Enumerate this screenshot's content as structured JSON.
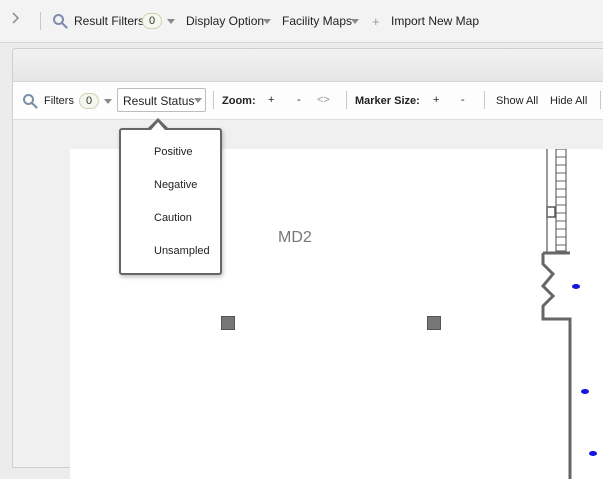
{
  "top_toolbar": {
    "result_filters_label": "Result Filters",
    "result_filters_count": "0",
    "display_option_label": "Display Option",
    "facility_maps_label": "Facility Maps",
    "import_label": "Import New Map"
  },
  "map_toolbar": {
    "filters_label": "Filters",
    "filters_count": "0",
    "result_status_label": "Result Status",
    "zoom_label": "Zoom:",
    "zoom_in": "+",
    "zoom_out": "-",
    "zoom_fit": "<>",
    "marker_size_label": "Marker Size:",
    "marker_increase": "+",
    "marker_decrease": "-",
    "show_all": "Show All",
    "hide_all": "Hide All"
  },
  "result_status_options": [
    "Positive",
    "Negative",
    "Caution",
    "Unsampled"
  ],
  "map": {
    "room_label": "MD2",
    "marker_color": "#1414e0"
  }
}
